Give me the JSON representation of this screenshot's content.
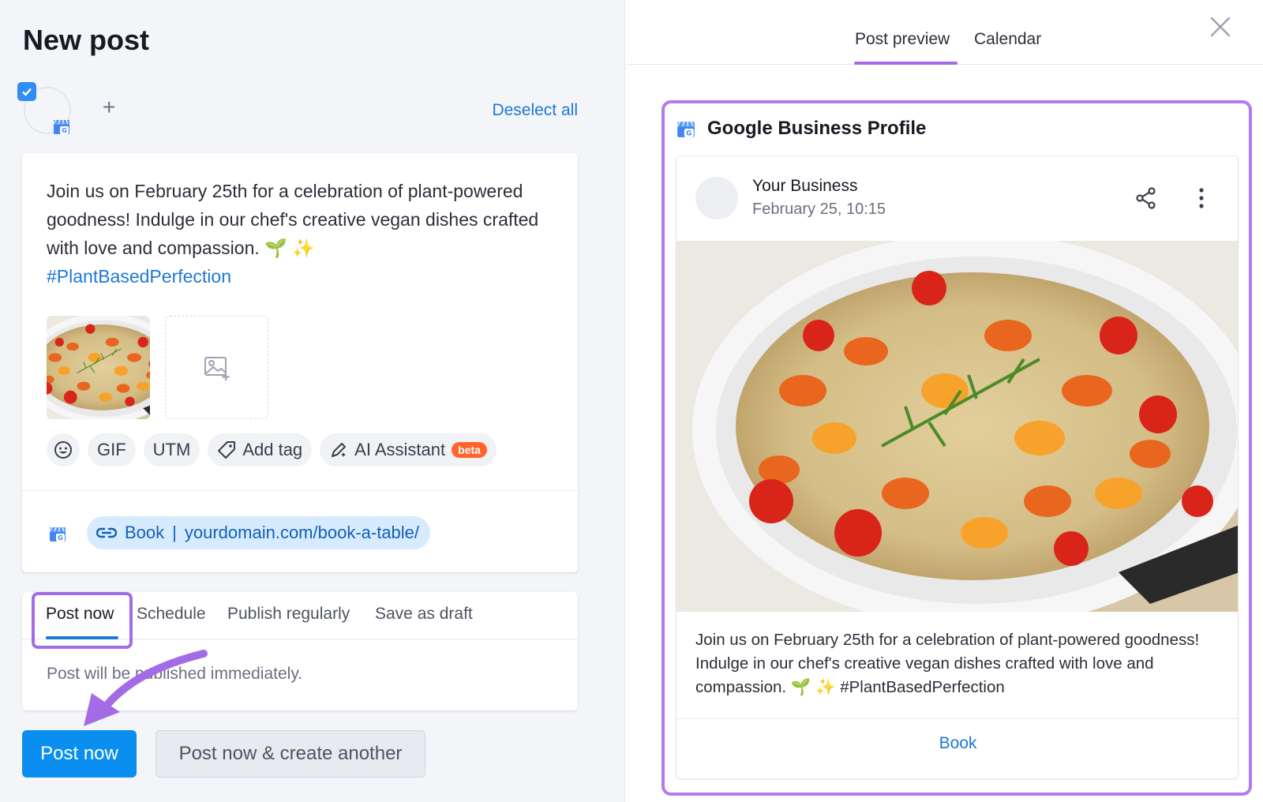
{
  "page_title": "New post",
  "accounts": {
    "deselect_label": "Deselect all",
    "add_label": "+"
  },
  "post": {
    "text": "Join us on February 25th for a celebration of plant-powered goodness! Indulge in our chef's creative vegan dishes crafted with love and compassion. 🌱 ✨",
    "hashtag": "#PlantBasedPerfection"
  },
  "toolbar": {
    "gif": "GIF",
    "utm": "UTM",
    "add_tag": "Add tag",
    "ai_assistant": "AI Assistant",
    "beta": "beta"
  },
  "link_button": {
    "label": "Book",
    "separator": "|",
    "url": "yourdomain.com/book-a-table/"
  },
  "publish": {
    "tabs": [
      "Post now",
      "Schedule",
      "Publish regularly",
      "Save as draft"
    ],
    "note": "Post will be published immediately."
  },
  "buttons": {
    "post_now": "Post now",
    "post_now_another": "Post now & create another"
  },
  "preview_tabs": [
    "Post preview",
    "Calendar"
  ],
  "preview": {
    "platform": "Google Business Profile",
    "business_name": "Your Business",
    "date": "February 25, 10:15",
    "text": "Join us on February 25th for a celebration of plant-powered goodness! Indulge in our chef's creative vegan dishes crafted with love and compassion. 🌱 ✨ #PlantBasedPerfection",
    "cta": "Book"
  },
  "colors": {
    "accent": "#0a8ff0",
    "highlight": "#a36ce6",
    "link": "#1d78d6",
    "beta": "#ff642d"
  },
  "icons": [
    "check-icon",
    "google-business-icon",
    "plus-icon",
    "emoji-icon",
    "tag-icon",
    "ai-pen-icon",
    "image-add-icon",
    "link-icon",
    "close-icon",
    "share-icon",
    "more-vertical-icon"
  ]
}
